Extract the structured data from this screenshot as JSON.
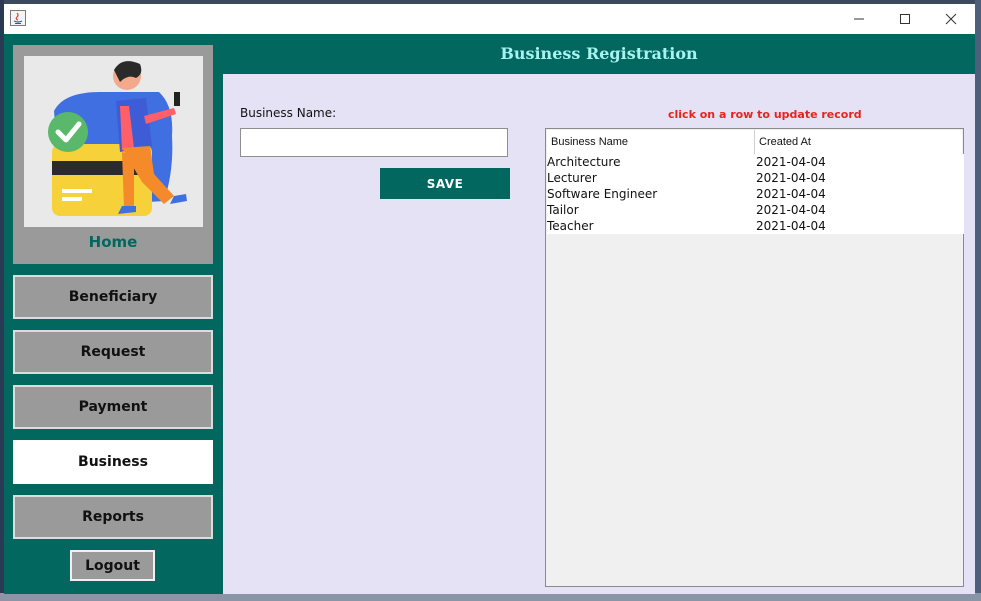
{
  "window": {
    "controls": [
      "minimize",
      "maximize",
      "close"
    ]
  },
  "sidebar": {
    "home_label": "Home",
    "items": [
      {
        "label": "Beneficiary",
        "active": false
      },
      {
        "label": "Request",
        "active": false
      },
      {
        "label": "Payment",
        "active": false
      },
      {
        "label": "Business",
        "active": true
      },
      {
        "label": "Reports",
        "active": false
      }
    ],
    "logout_label": "Logout"
  },
  "header": {
    "title": "Business Registration"
  },
  "form": {
    "business_name_label": "Business Name:",
    "business_name_value": "",
    "save_label": "SAVE"
  },
  "table": {
    "hint": "click on a row to update record",
    "columns": [
      "Business Name",
      "Created At"
    ],
    "rows": [
      [
        "Architecture",
        "2021-04-04"
      ],
      [
        "Lecturer",
        "2021-04-04"
      ],
      [
        "Software Engineer",
        "2021-04-04"
      ],
      [
        "Tailor",
        "2021-04-04"
      ],
      [
        "Teacher",
        "2021-04-04"
      ]
    ]
  },
  "colors": {
    "primary_teal": "#02675f",
    "header_title": "#a7f3f0",
    "content_bg": "#e6e2f5",
    "hint_red": "#e8231f",
    "nav_gray": "#9a9a9a"
  }
}
